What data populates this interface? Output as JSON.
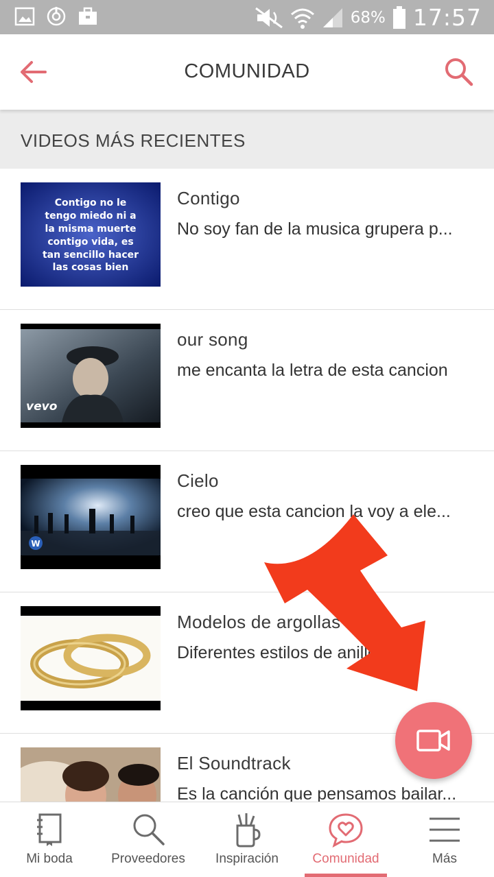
{
  "status_bar": {
    "battery": "68%",
    "time": "17:57",
    "icons": [
      "image-icon",
      "sync-icon",
      "briefcase-icon",
      "mute-icon",
      "wifi-icon",
      "signal-icon",
      "battery-icon"
    ]
  },
  "app_bar": {
    "title": "COMUNIDAD",
    "back_icon": "back-arrow-icon",
    "search_icon": "search-icon",
    "accent_color": "#e26b73"
  },
  "section": {
    "title": "VIDEOS MÁS RECIENTES"
  },
  "videos": [
    {
      "title": "Contigo",
      "description": "No soy fan de la musica grupera p...",
      "thumb_lines": [
        "Contigo no le",
        "tengo miedo ni a",
        "la misma muerte",
        "contigo vida, es",
        "tan sencillo hacer",
        "las cosas bien"
      ]
    },
    {
      "title": "our song",
      "description": "me encanta la letra de esta cancion",
      "thumb_badge": "vevo"
    },
    {
      "title": "Cielo",
      "description": "creo que esta cancion la voy a ele..."
    },
    {
      "title": "Modelos de argollas",
      "description": "Diferentes estilos de anillos"
    },
    {
      "title": "El Soundtrack",
      "description": "Es la canción que pensamos bailar..."
    }
  ],
  "fab": {
    "icon": "video-camera-icon",
    "color": "#f07278"
  },
  "bottom_nav": [
    {
      "label": "Mi boda",
      "icon": "notebook-icon"
    },
    {
      "label": "Proveedores",
      "icon": "search-icon"
    },
    {
      "label": "Inspiración",
      "icon": "inspiration-cup-icon"
    },
    {
      "label": "Comunidad",
      "icon": "chat-heart-icon",
      "active": true
    },
    {
      "label": "Más",
      "icon": "menu-icon"
    }
  ]
}
